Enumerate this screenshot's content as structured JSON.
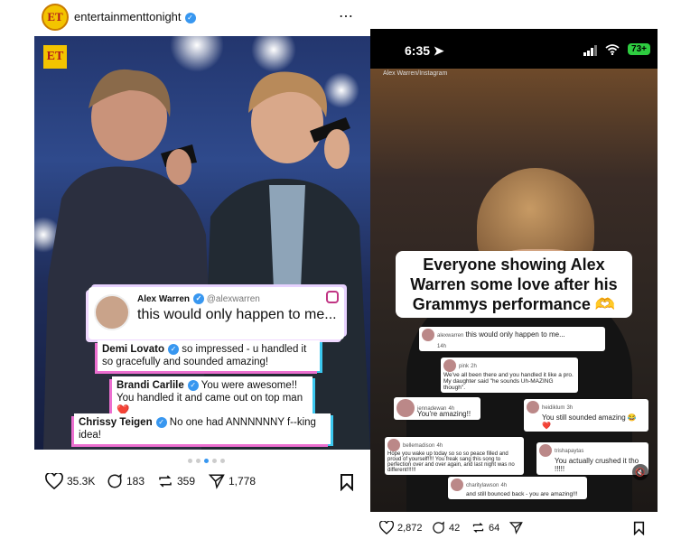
{
  "left": {
    "account": "entertainmenttonight",
    "avatar_text": "ET",
    "more_icon": "⋯",
    "logo_text": "ET",
    "card_main": {
      "name": "Alex Warren",
      "handle": "@alexwarren",
      "text": "this would only happen to me..."
    },
    "comments": [
      {
        "name": "Demi Lovato",
        "text": "so impressed - u handled it so gracefully and sounded amazing!"
      },
      {
        "name": "Brandi Carlile",
        "text": "You were awesome!! You handled it and came out on top man ❤️"
      },
      {
        "name": "Chrissy Teigen",
        "text": "No one had ANNNNNNY f--king idea!"
      }
    ],
    "actions": {
      "likes": "35.3K",
      "comments": "183",
      "reposts": "359",
      "shares": "1,778"
    }
  },
  "right": {
    "time": "6:35",
    "battery": "73+",
    "credit": "Alex Warren/Instagram",
    "caption": "Everyone showing Alex Warren some love after his Grammys performance 🫶",
    "comments": [
      {
        "name": "alexwarren",
        "time": "14h",
        "text": "this would only happen to me..."
      },
      {
        "name": "pink",
        "time": "2h",
        "text": "We've all been there and you handled it like a pro. My daughter said \"he sounds Uh-MAZING though\"."
      },
      {
        "name": "jennadewan",
        "time": "4h",
        "text": "You're amazing!!"
      },
      {
        "name": "heidiklum",
        "time": "3h",
        "text": "You still sounded amazing 😂 ❤️"
      },
      {
        "name": "bellemadison",
        "time": "4h",
        "text": "Hope you wake up today so so so peace filled and proud of yourself!!!! You freak sang this song to perfection over and over again, and last night was no different!!!!!!"
      },
      {
        "name": "trishapaytas",
        "time": "",
        "text": "You actually crushed it tho !!!!!"
      },
      {
        "name": "charitylawson",
        "time": "4h",
        "text": "and still bounced back - you are amazing!!!"
      }
    ],
    "actions": {
      "likes": "2,872",
      "comments": "42",
      "reposts": "64"
    }
  }
}
